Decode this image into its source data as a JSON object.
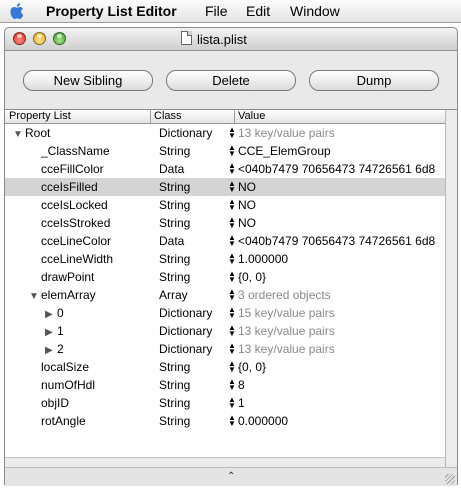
{
  "menubar": {
    "app_name": "Property List Editor",
    "items": [
      "File",
      "Edit",
      "Window"
    ]
  },
  "window": {
    "title": "lista.plist"
  },
  "toolbar": {
    "new_sibling_label": "New Sibling",
    "delete_label": "Delete",
    "dump_label": "Dump"
  },
  "table": {
    "columns": [
      "Property List",
      "Class",
      "Value"
    ],
    "rows": [
      {
        "key": "Root",
        "class": "Dictionary",
        "value": "13 key/value pairs",
        "indent": 0,
        "disclosure": "open",
        "gray": true
      },
      {
        "key": "_ClassName",
        "class": "String",
        "value": "CCE_ElemGroup",
        "indent": 1,
        "disclosure": "none",
        "gray": false
      },
      {
        "key": "cceFillColor",
        "class": "Data",
        "value": "<040b7479 70656473 74726561 6d8",
        "indent": 1,
        "disclosure": "none",
        "gray": false
      },
      {
        "key": "cceIsFilled",
        "class": "String",
        "value": "NO",
        "indent": 1,
        "disclosure": "none",
        "gray": false,
        "selected": true
      },
      {
        "key": "cceIsLocked",
        "class": "String",
        "value": "NO",
        "indent": 1,
        "disclosure": "none",
        "gray": false
      },
      {
        "key": "cceIsStroked",
        "class": "String",
        "value": "NO",
        "indent": 1,
        "disclosure": "none",
        "gray": false
      },
      {
        "key": "cceLineColor",
        "class": "Data",
        "value": "<040b7479 70656473 74726561 6d8",
        "indent": 1,
        "disclosure": "none",
        "gray": false
      },
      {
        "key": "cceLineWidth",
        "class": "String",
        "value": "1.000000",
        "indent": 1,
        "disclosure": "none",
        "gray": false
      },
      {
        "key": "drawPoint",
        "class": "String",
        "value": "{0, 0}",
        "indent": 1,
        "disclosure": "none",
        "gray": false
      },
      {
        "key": "elemArray",
        "class": "Array",
        "value": "3 ordered objects",
        "indent": 1,
        "disclosure": "open",
        "gray": true
      },
      {
        "key": "0",
        "class": "Dictionary",
        "value": "15 key/value pairs",
        "indent": 2,
        "disclosure": "closed",
        "gray": true
      },
      {
        "key": "1",
        "class": "Dictionary",
        "value": "13 key/value pairs",
        "indent": 2,
        "disclosure": "closed",
        "gray": true
      },
      {
        "key": "2",
        "class": "Dictionary",
        "value": "13 key/value pairs",
        "indent": 2,
        "disclosure": "closed",
        "gray": true
      },
      {
        "key": "localSize",
        "class": "String",
        "value": "{0, 0}",
        "indent": 1,
        "disclosure": "none",
        "gray": false
      },
      {
        "key": "numOfHdl",
        "class": "String",
        "value": "8",
        "indent": 1,
        "disclosure": "none",
        "gray": false
      },
      {
        "key": "objID",
        "class": "String",
        "value": "1",
        "indent": 1,
        "disclosure": "none",
        "gray": false
      },
      {
        "key": "rotAngle",
        "class": "String",
        "value": "0.000000",
        "indent": 1,
        "disclosure": "none",
        "gray": false
      }
    ]
  }
}
